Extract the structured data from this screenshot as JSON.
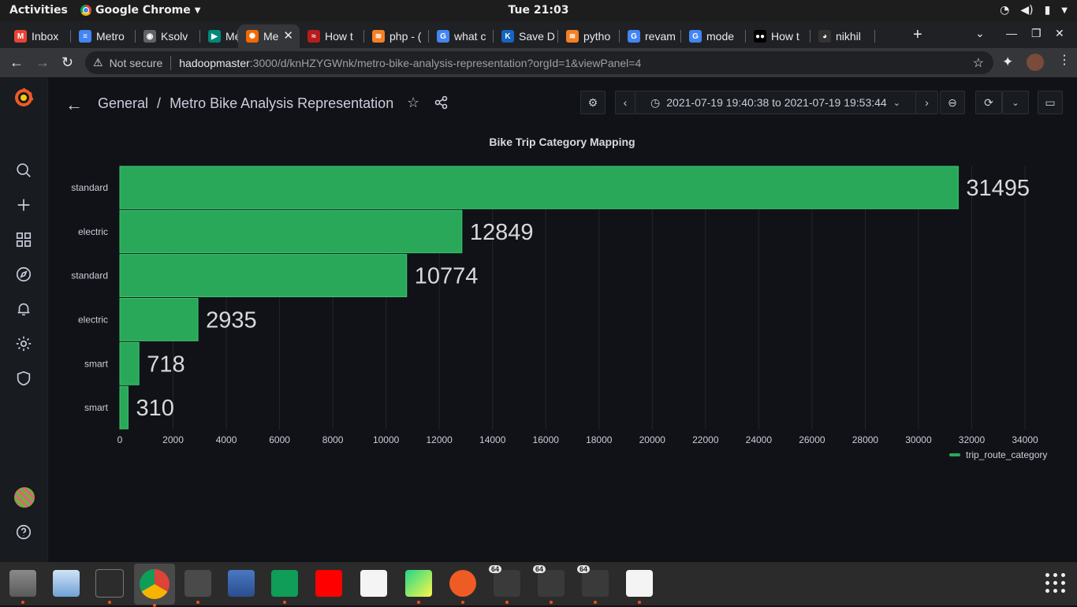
{
  "system_bar": {
    "activities": "Activities",
    "app_name": "Google Chrome",
    "clock": "Tue 21:03"
  },
  "browser": {
    "tabs": [
      {
        "label": "Inbox",
        "icon": "gmail-icon",
        "color": "#ea4335",
        "glyph": "M"
      },
      {
        "label": "Metro",
        "icon": "docs-icon",
        "color": "#4285f4",
        "glyph": "≡"
      },
      {
        "label": "Ksolv",
        "icon": "chrome-icon",
        "color": "#5f6368",
        "glyph": "◉"
      },
      {
        "label": "Me",
        "icon": "meet-icon",
        "color": "#00897b",
        "glyph": "▶"
      },
      {
        "label": "Me",
        "icon": "grafana-icon",
        "color": "#f46800",
        "glyph": "✺",
        "active": true
      },
      {
        "label": "How t",
        "icon": "red-swoosh-icon",
        "color": "#b71c1c",
        "glyph": "≈"
      },
      {
        "label": "php - (",
        "icon": "stackoverflow-icon",
        "color": "#f48024",
        "glyph": "≋"
      },
      {
        "label": "what c",
        "icon": "google-icon",
        "color": "#4285f4",
        "glyph": "G"
      },
      {
        "label": "Save D",
        "icon": "k-icon",
        "color": "#1565c0",
        "glyph": "K"
      },
      {
        "label": "pytho",
        "icon": "stackoverflow-icon",
        "color": "#f48024",
        "glyph": "≋"
      },
      {
        "label": "revam",
        "icon": "google-icon",
        "color": "#4285f4",
        "glyph": "G"
      },
      {
        "label": "mode",
        "icon": "google-icon",
        "color": "#4285f4",
        "glyph": "G"
      },
      {
        "label": "How t",
        "icon": "medium-icon",
        "color": "#000000",
        "glyph": "●●"
      },
      {
        "label": "nikhil",
        "icon": "github-icon",
        "color": "#333333",
        "glyph": "◕"
      }
    ],
    "url_warning": "Not secure",
    "url_host": "hadoopmaster",
    "url_path": ":3000/d/knHZYGWnk/metro-bike-analysis-representation?orgId=1&viewPanel=4"
  },
  "dashboard": {
    "folder": "General",
    "separator": "/",
    "title": "Metro Bike Analysis Representation",
    "time_range": "2021-07-19 19:40:38 to 2021-07-19 19:53:44"
  },
  "panel": {
    "title": "Bike Trip Category Mapping",
    "legend": "trip_route_category"
  },
  "chart_data": {
    "type": "bar",
    "orientation": "horizontal",
    "title": "Bike Trip Category Mapping",
    "categories": [
      "standard",
      "electric",
      "standard",
      "electric",
      "smart",
      "smart"
    ],
    "values": [
      31495,
      12849,
      10774,
      2935,
      718,
      310
    ],
    "series": [
      {
        "name": "trip_route_category",
        "values": [
          31495,
          12849,
          10774,
          2935,
          718,
          310
        ],
        "color": "#2aa85a"
      }
    ],
    "xticks": [
      0,
      2000,
      4000,
      6000,
      8000,
      10000,
      12000,
      14000,
      16000,
      18000,
      20000,
      22000,
      24000,
      26000,
      28000,
      30000,
      32000,
      34000
    ],
    "xlim": [
      0,
      34000
    ],
    "grid": true,
    "legend_position": "bottom-right",
    "bar_color": "#2aa85a"
  },
  "dock": {
    "items": [
      {
        "icon": "files-icon",
        "running": true
      },
      {
        "icon": "document-viewer-icon",
        "running": false
      },
      {
        "icon": "terminal-icon",
        "running": true
      },
      {
        "icon": "chrome-icon",
        "running": true,
        "active": true
      },
      {
        "icon": "sublime-text-icon",
        "running": true
      },
      {
        "icon": "virtualbox-icon",
        "running": false
      },
      {
        "icon": "hangouts-icon",
        "running": true
      },
      {
        "icon": "youtube-icon",
        "running": false
      },
      {
        "icon": "draw-icon",
        "running": false
      },
      {
        "icon": "pycharm-icon",
        "running": true
      },
      {
        "icon": "postman-icon",
        "running": true
      },
      {
        "icon": "app-64-icon",
        "running": true
      },
      {
        "icon": "app-64-icon",
        "running": true
      },
      {
        "icon": "app-64-icon",
        "running": true
      },
      {
        "icon": "spreadsheet-icon",
        "running": true
      }
    ],
    "badge": "64"
  }
}
